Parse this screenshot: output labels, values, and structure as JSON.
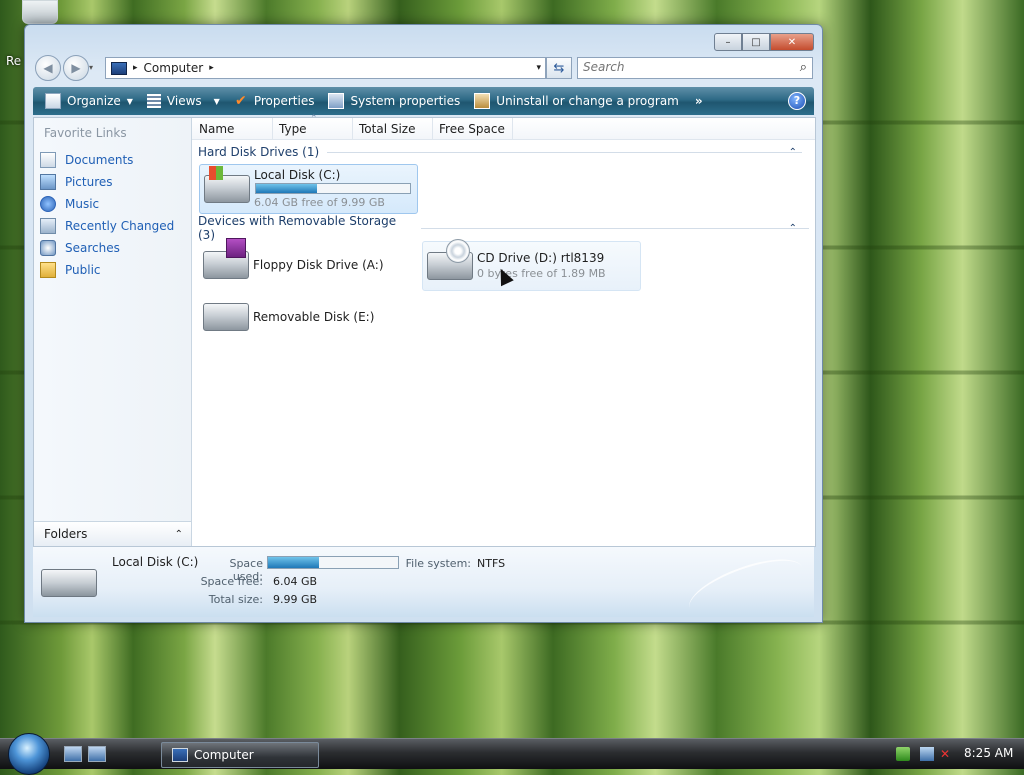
{
  "desktop": {
    "recycle_label": "Re"
  },
  "window": {
    "caption": {
      "min": "–",
      "max": "□",
      "close": "✕"
    },
    "nav": {
      "back": "◀",
      "forward": "▶"
    },
    "address": {
      "sep": "▸",
      "path": "Computer",
      "after": "▸",
      "dropdown": "▾"
    },
    "refresh_icon": "⇆",
    "search": {
      "placeholder": "Search",
      "icon": "⌕"
    },
    "toolbar": {
      "organize": "Organize",
      "views": "Views",
      "properties": "Properties",
      "system_properties": "System properties",
      "uninstall": "Uninstall or change a program",
      "more": "»",
      "help": "?"
    },
    "nav_pane": {
      "title": "Favorite Links",
      "links": [
        "Documents",
        "Pictures",
        "Music",
        "Recently Changed",
        "Searches",
        "Public"
      ],
      "folders_label": "Folders",
      "folders_chevron": "⌃"
    },
    "columns": [
      "Name",
      "Type",
      "Total Size",
      "Free Space"
    ],
    "groups": [
      {
        "title": "Hard Disk Drives (1)",
        "chevron": "⌃"
      },
      {
        "title": "Devices with Removable Storage (3)",
        "chevron": "⌃"
      }
    ],
    "drives": {
      "local_c": {
        "name": "Local Disk (C:)",
        "sub": "6.04 GB free of 9.99 GB",
        "used_fraction": 0.395
      },
      "floppy": {
        "name": "Floppy Disk Drive (A:)"
      },
      "cd": {
        "name": "CD Drive (D:) rtl8139",
        "sub": "0 bytes free of 1.89 MB"
      },
      "removable": {
        "name": "Removable Disk (E:)"
      }
    },
    "details": {
      "name": "Local Disk (C:)",
      "space_used_label": "Space used:",
      "space_free_label": "Space free:",
      "space_free": "6.04 GB",
      "total_label": "Total size:",
      "total": "9.99 GB",
      "fs_label": "File system:",
      "fs": "NTFS",
      "used_fraction": 0.395
    }
  },
  "taskbar": {
    "task": "Computer",
    "clock": "8:25 AM"
  },
  "colors": {
    "accent": "#2e6a86",
    "link": "#1f5fb5",
    "group_text": "#1e3f6b"
  }
}
